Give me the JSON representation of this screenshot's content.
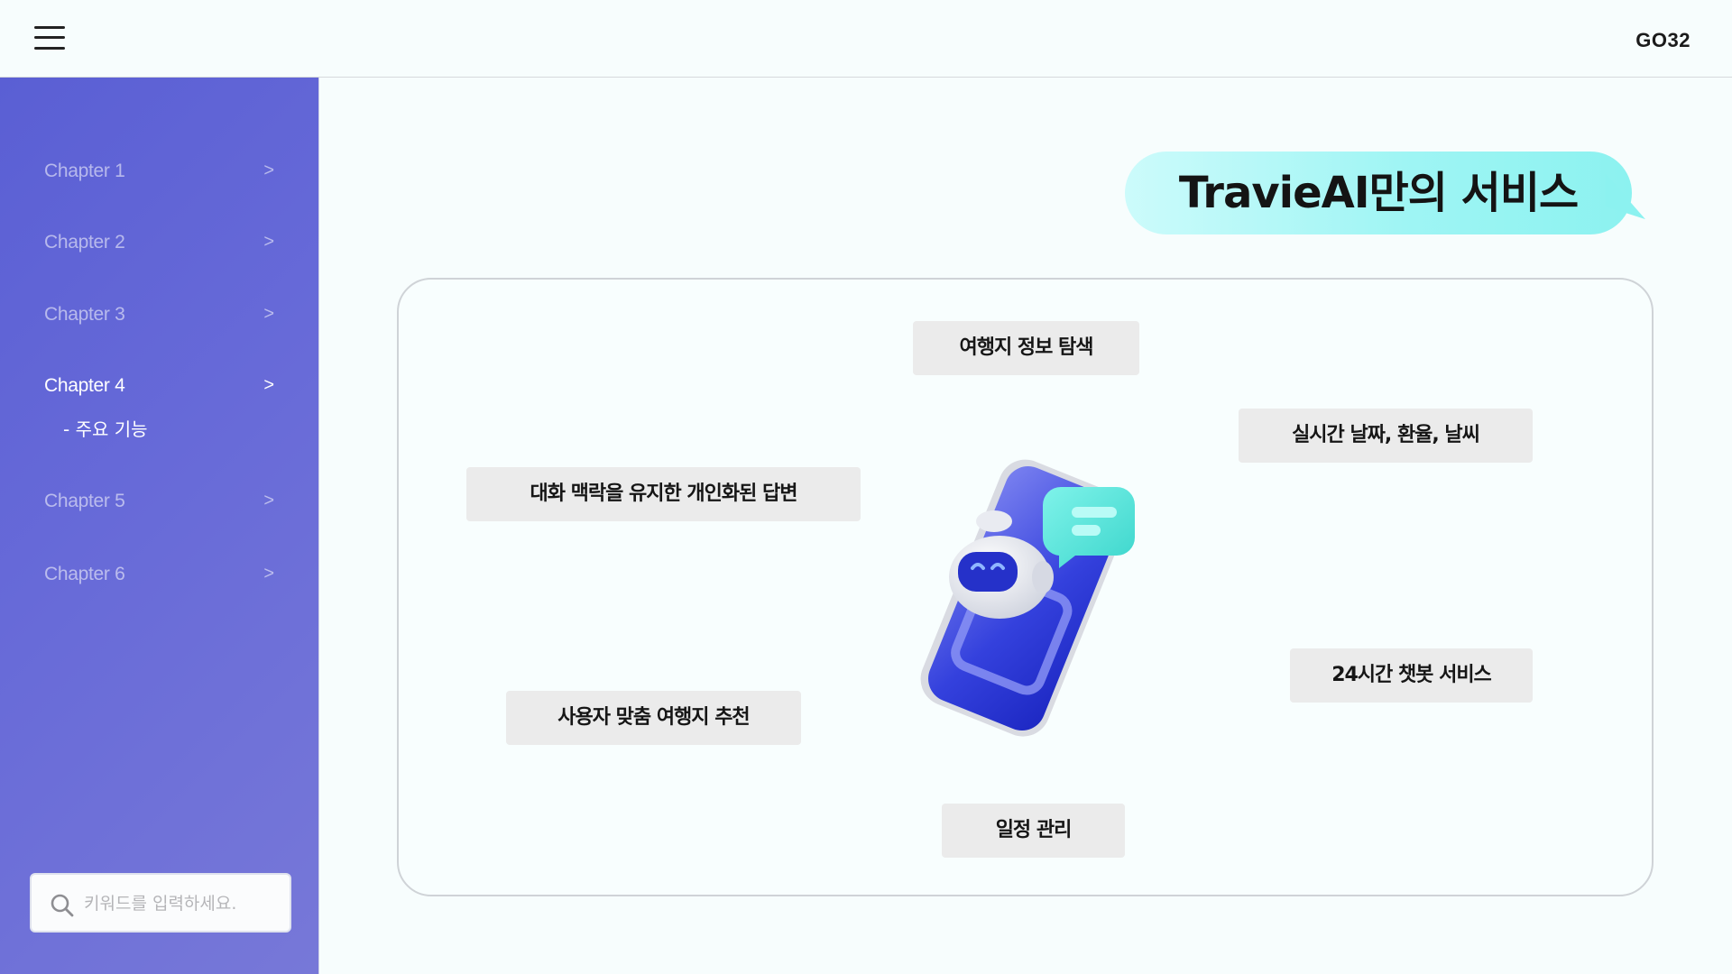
{
  "header": {
    "menu_icon": "hamburger-menu-icon",
    "brand": "GO32"
  },
  "sidebar": {
    "items": [
      {
        "label": "Chapter 1",
        "chevron": ">",
        "active": false
      },
      {
        "label": "Chapter 2",
        "chevron": ">",
        "active": false
      },
      {
        "label": "Chapter 3",
        "chevron": ">",
        "active": false
      },
      {
        "label": "Chapter 4",
        "chevron": ">",
        "active": true
      },
      {
        "label": "Chapter 5",
        "chevron": ">",
        "active": false
      },
      {
        "label": "Chapter 6",
        "chevron": ">",
        "active": false
      }
    ],
    "subitem": "- 주요 기능",
    "search": {
      "icon": "search-icon",
      "placeholder": "키워드를 입력하세요.",
      "value": ""
    }
  },
  "main": {
    "title": "TravieAI만의 서비스",
    "features": [
      "여행지 정보 탐색",
      "실시간 날짜, 환율, 날씨",
      "대화 맥락을 유지한 개인화된 답변",
      "24시간 챗봇 서비스",
      "사용자 맞춤 여행지 추천",
      "일정 관리"
    ],
    "illustration": "robot-phone-chat-icon"
  },
  "colors": {
    "sidebar_gradient_start": "#5a5fd4",
    "sidebar_gradient_end": "#7778d8",
    "title_bubble": "#9ff5f4",
    "feature_bg": "#ebebeb"
  }
}
